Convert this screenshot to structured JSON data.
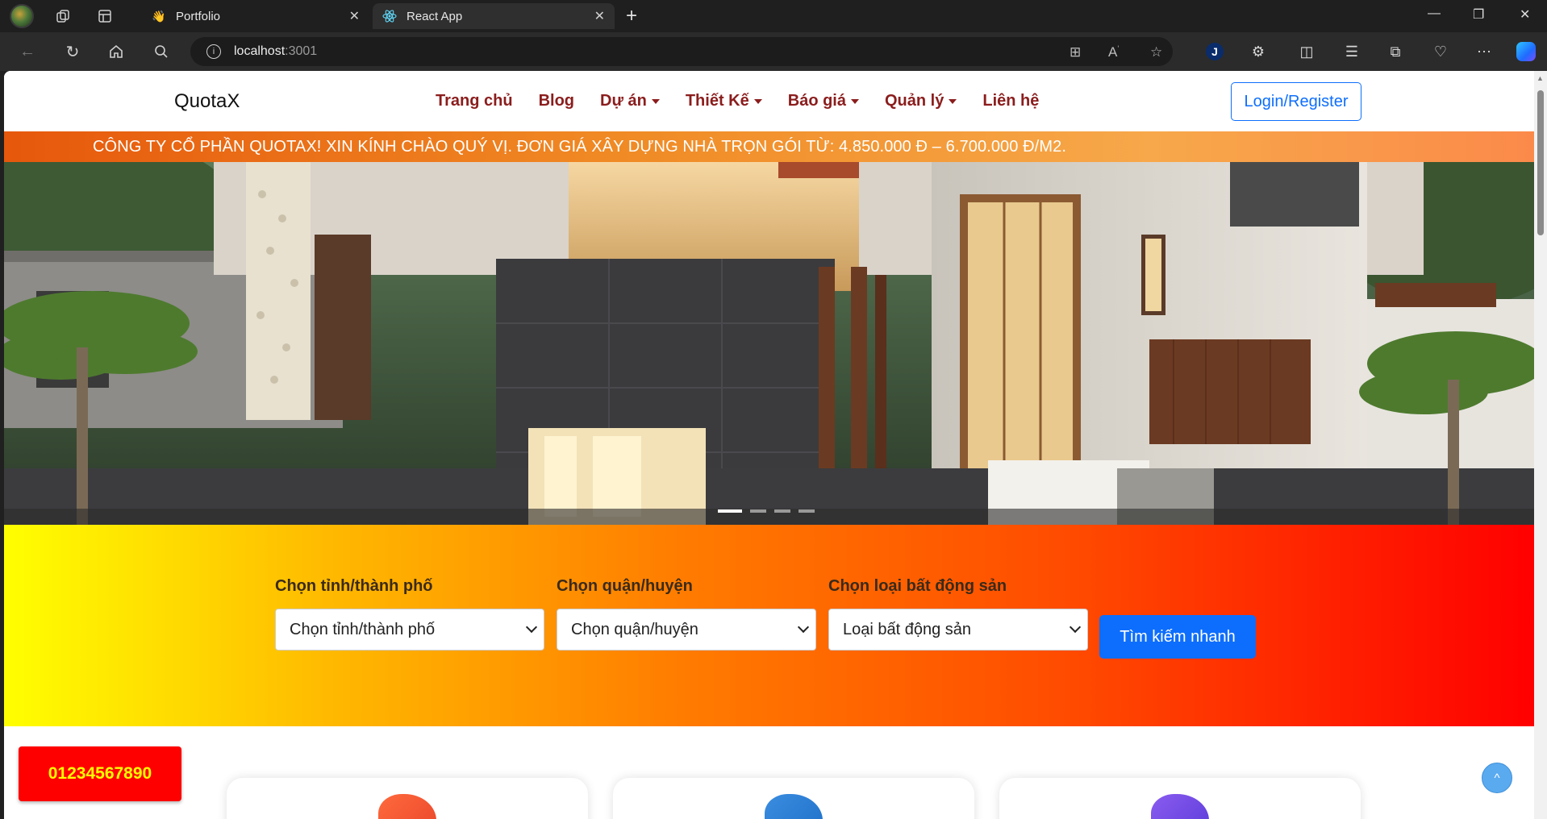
{
  "browser": {
    "tabs": [
      {
        "title": "Portfolio",
        "icon": "waving-hand-icon"
      },
      {
        "title": "React App",
        "icon": "react-icon",
        "active": true
      }
    ],
    "url": {
      "host": "localhost",
      "port": ":3001"
    }
  },
  "site": {
    "brand": "QuotaX",
    "nav": [
      {
        "label": "Trang chủ",
        "dropdown": false
      },
      {
        "label": "Blog",
        "dropdown": false
      },
      {
        "label": "Dự án",
        "dropdown": true
      },
      {
        "label": "Thiết Kế",
        "dropdown": true
      },
      {
        "label": "Báo giá",
        "dropdown": true
      },
      {
        "label": "Quản lý",
        "dropdown": true
      },
      {
        "label": "Liên hệ",
        "dropdown": false
      }
    ],
    "login_label": "Login/Register",
    "marquee": "CÔNG TY CỔ PHẦN QUOTAX! XIN KÍNH CHÀO QUÝ VỊ. ĐƠN GIÁ XÂY DỰNG NHÀ TRỌN GÓI TỪ: 4.850.000 Đ – 6.700.000 Đ/M2.",
    "carousel": {
      "slides": 4,
      "active": 1
    },
    "search": {
      "fields": [
        {
          "label": "Chọn tỉnh/thành phố",
          "value": "Chọn tỉnh/thành phố"
        },
        {
          "label": "Chọn quận/huyện",
          "value": "Chọn quận/huyện"
        },
        {
          "label": "Chọn loại bất động sản",
          "value": "Loại bất động sản"
        }
      ],
      "button": "Tìm kiếm nhanh"
    },
    "phone": "01234567890",
    "back_to_top": "^",
    "colors": {
      "nav_text": "#8b1d1d",
      "primary": "#0d6efd",
      "phone_bg": "#ff0000",
      "phone_text": "#ffff00"
    }
  }
}
